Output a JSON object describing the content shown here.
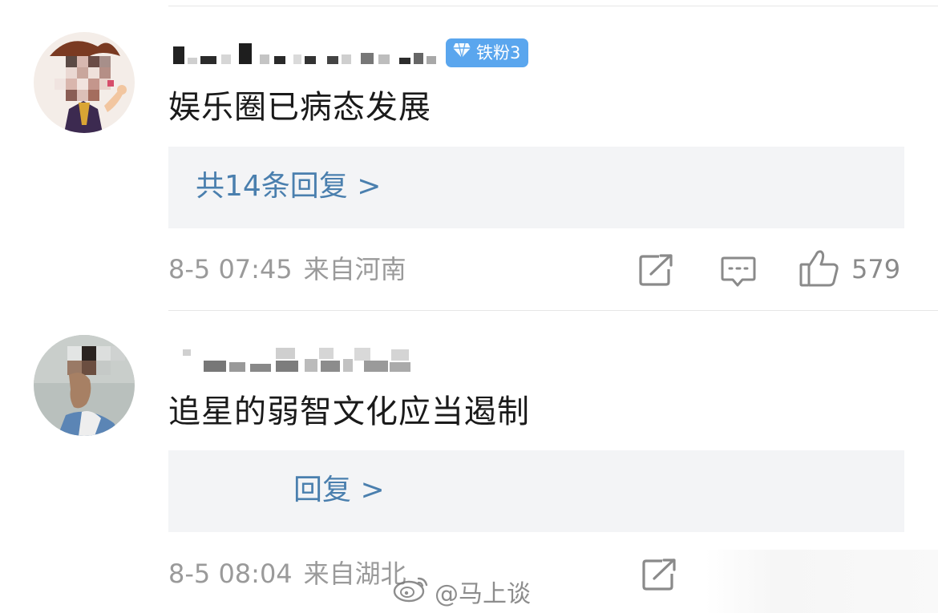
{
  "comments": [
    {
      "username": "",
      "badge": {
        "label": "铁粉3",
        "color": "#5aa6ee"
      },
      "text": "娱乐圈已病态发展",
      "replies_label": "共14条回复 >",
      "date": "8-5 07:45",
      "location": "来自河南",
      "likes": "579"
    },
    {
      "username": "",
      "text": "追星的弱智文化应当遏制",
      "replies_label": "回复 >",
      "date": "8-5 08:04",
      "location": "来自湖北"
    }
  ],
  "watermark": {
    "text": "@马上谈",
    "icon": "weibo-logo-icon"
  },
  "colors": {
    "link": "#4a7fae",
    "meta": "#9a9a9a",
    "reply_bg": "#f3f4f6"
  }
}
